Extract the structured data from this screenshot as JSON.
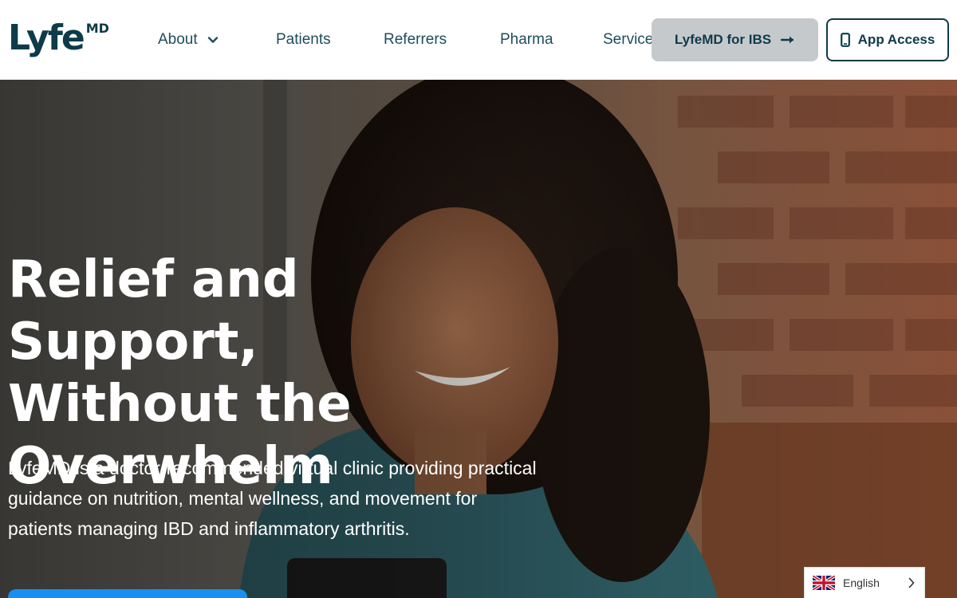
{
  "logo": {
    "text": "Lyfe",
    "superscript": "MD"
  },
  "nav": {
    "items": [
      {
        "label": "About",
        "has_dropdown": true
      },
      {
        "label": "Patients"
      },
      {
        "label": "Referrers"
      },
      {
        "label": "Pharma"
      },
      {
        "label": "Services"
      }
    ]
  },
  "header_buttons": {
    "ibs_label": "LyfeMD for IBS",
    "ibs_icon": "arrow-right-icon",
    "app_label": "App Access",
    "app_icon": "phone-icon"
  },
  "hero": {
    "title_lines": [
      "Relief and Support,",
      "Without the",
      "Overwhelm"
    ],
    "description": "LyfeMD is a doctor-recommended virtual clinic providing practical guidance on nutrition, mental wellness, and movement for patients managing IBD and inflammatory arthritis."
  },
  "language": {
    "label": "English",
    "icon": "uk-flag-icon"
  },
  "colors": {
    "brand": "#0d3b4a",
    "nav_text": "#1e4d5c",
    "cta_blue": "#1a8ff0",
    "ibs_button_bg": "#c6c9cb"
  }
}
